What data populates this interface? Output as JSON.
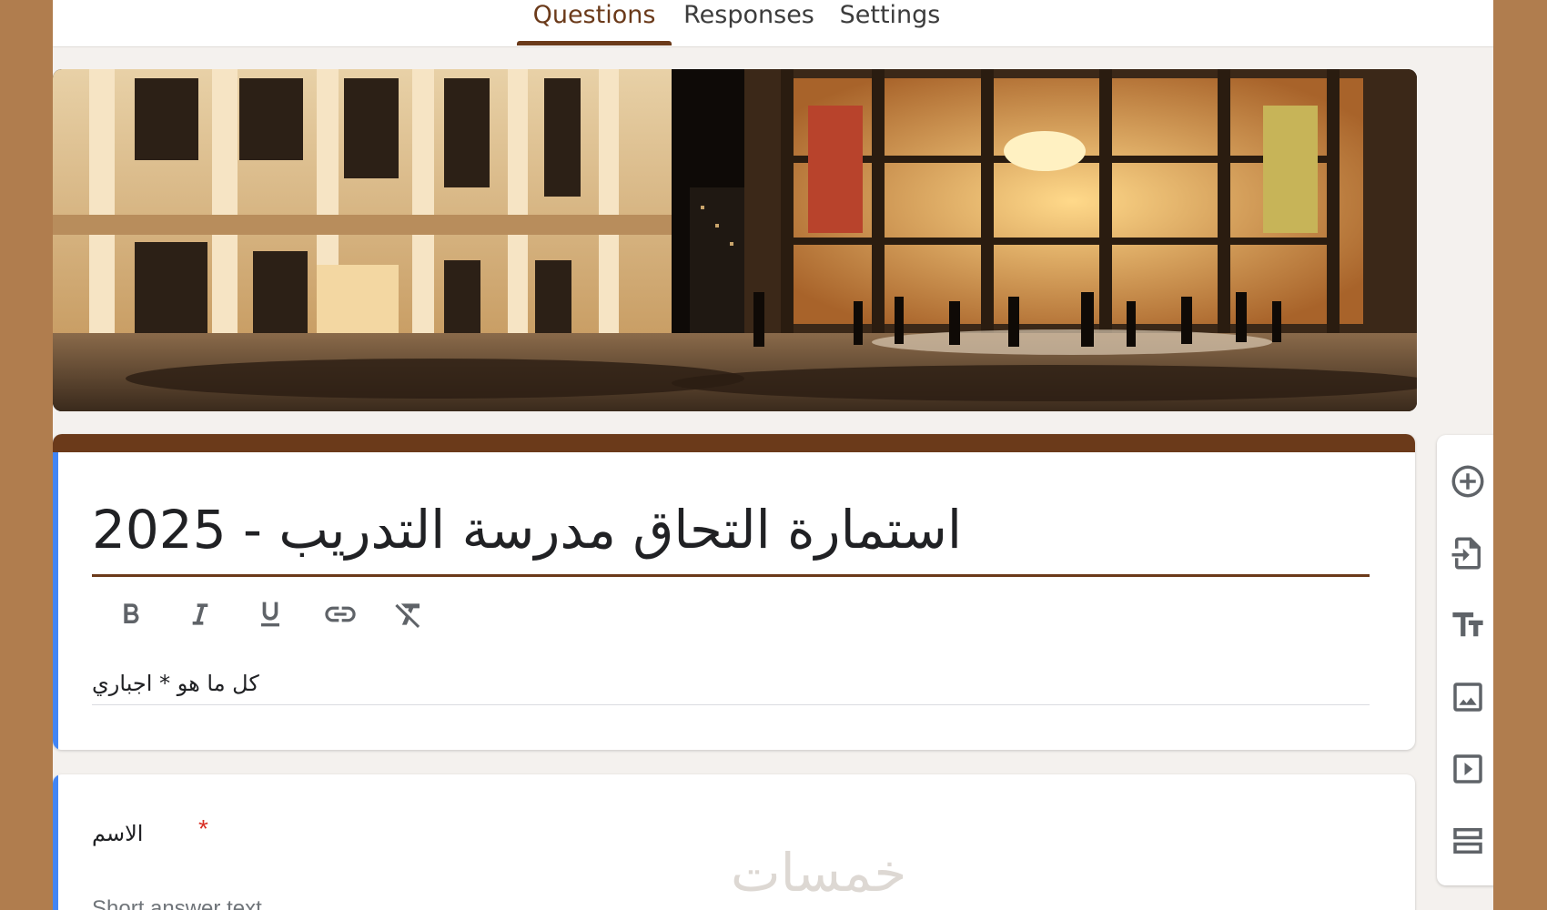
{
  "tabs": [
    {
      "label": "Questions",
      "active": true
    },
    {
      "label": "Responses",
      "active": false
    },
    {
      "label": "Settings",
      "active": false
    }
  ],
  "banner": {
    "description": "header-image"
  },
  "form": {
    "title": "استمارة التحاق مدرسة التدريب - 2025",
    "description": "كل ما هو * اجباري"
  },
  "formatting": {
    "buttons": [
      {
        "name": "bold",
        "icon": "bold-icon"
      },
      {
        "name": "italic",
        "icon": "italic-icon"
      },
      {
        "name": "underline",
        "icon": "underline-icon"
      },
      {
        "name": "link",
        "icon": "link-icon"
      },
      {
        "name": "clear-format",
        "icon": "clear-format-icon"
      }
    ]
  },
  "question": {
    "label": "الاسم",
    "required_mark": "*",
    "placeholder": "Short answer text"
  },
  "side_toolbar": {
    "buttons": [
      {
        "name": "add-question",
        "icon": "add-circle-icon"
      },
      {
        "name": "import-questions",
        "icon": "import-icon"
      },
      {
        "name": "add-title",
        "icon": "text-title-icon"
      },
      {
        "name": "add-image",
        "icon": "image-icon"
      },
      {
        "name": "add-video",
        "icon": "video-icon"
      },
      {
        "name": "add-section",
        "icon": "section-icon"
      }
    ]
  },
  "watermark": "خمسات",
  "colors": {
    "accent": "#6b3a1a",
    "frame": "#b07d4e",
    "focus_bar": "#4285f4",
    "required": "#d93025"
  }
}
